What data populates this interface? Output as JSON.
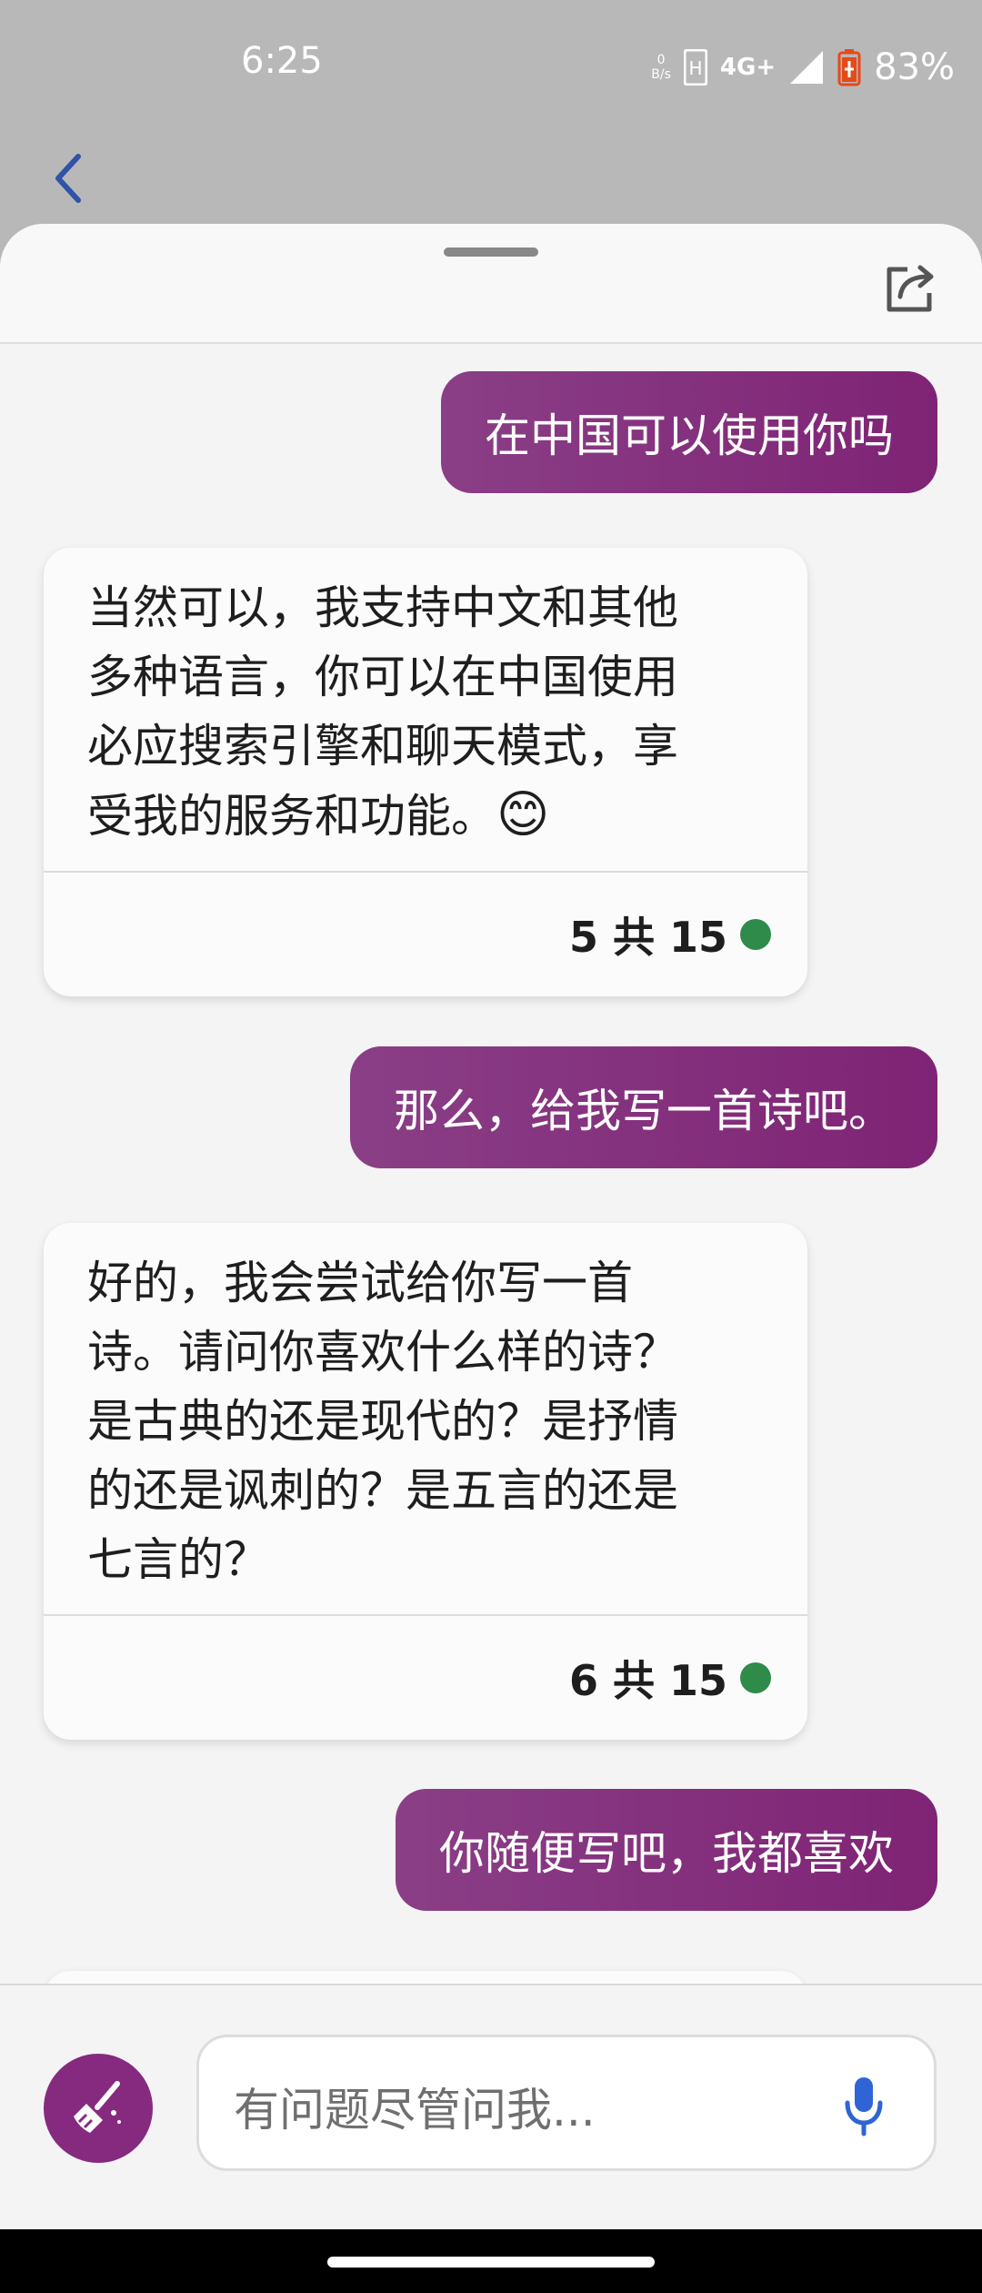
{
  "status_bar": {
    "time": "6:25",
    "net_speed_value": "0",
    "net_speed_unit": "B/s",
    "network": "4G+",
    "battery": "83%"
  },
  "icons": {
    "back": "chevron-left-icon",
    "share": "share-icon",
    "broom": "broom-icon",
    "mic": "microphone-icon"
  },
  "colors": {
    "accent": "#862a7f",
    "bubble_user_start": "#8a3f86",
    "bubble_user_end": "#7f2375",
    "status_dot": "#2e8b4a",
    "back_icon": "#2f53a7",
    "mic_icon": "#2f64d6"
  },
  "messages": [
    {
      "role": "user",
      "text": "在中国可以使用你吗"
    },
    {
      "role": "bot",
      "lines": [
        "当然可以，我支持中文和其他",
        "多种语言，你可以在中国使用",
        "必应搜索引擎和聊天模式，享",
        "受我的服务和功能。"
      ],
      "emoji": "😊",
      "count": "5 共 15"
    },
    {
      "role": "user",
      "text": "那么，给我写一首诗吧。"
    },
    {
      "role": "bot",
      "lines": [
        "好的，我会尝试给你写一首",
        "诗。请问你喜欢什么样的诗？",
        "是古典的还是现代的？是抒情",
        "的还是讽刺的？是五言的还是",
        "七言的？"
      ],
      "count": "6 共 15"
    },
    {
      "role": "user",
      "text": "你随便写吧，我都喜欢"
    }
  ],
  "input": {
    "placeholder": "有问题尽管问我..."
  }
}
